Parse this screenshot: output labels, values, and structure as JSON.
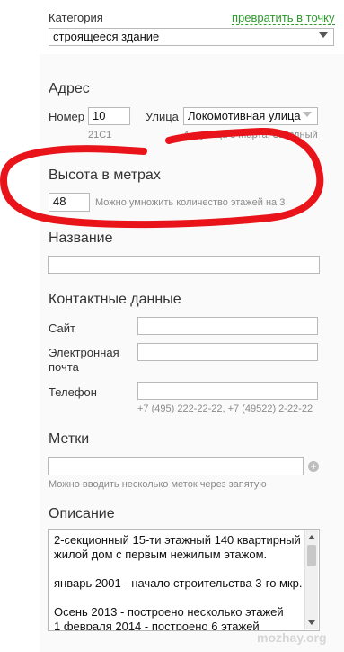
{
  "category": {
    "label": "Категория",
    "convert_link": "превратить в точку",
    "selected": "строящееся здание"
  },
  "address": {
    "heading": "Адрес",
    "number_label": "Номер",
    "number_value": "10",
    "number_hint": "21С1",
    "street_label": "Улица",
    "street_value": "Локомотивная улица",
    "street_hint": "4-я улица 8 Марта, Звёздный"
  },
  "height": {
    "heading": "Высота в метрах",
    "value": "48",
    "hint": "Можно умножить количество этажей на 3"
  },
  "name": {
    "heading": "Название",
    "value": ""
  },
  "contacts": {
    "heading": "Контактные данные",
    "site_label": "Сайт",
    "email_label_1": "Электронная",
    "email_label_2": "почта",
    "phone_label": "Телефон",
    "phone_hint": "+7 (495) 222-22-22, +7 (49522) 2-22-22"
  },
  "tags": {
    "heading": "Метки",
    "hint": "Можно вводить несколько меток через запятую"
  },
  "description": {
    "heading": "Описание",
    "line1": "2-секционный 15-ти этажный 140 квартирный",
    "line2": "жилой дом с первым нежилым этажом.",
    "line3": "январь 2001 - начало строительства 3-го мкр.",
    "line4": "Осень 2013 - построено несколько этажей",
    "line5": "1 февраля 2014 - построено 6 этажей"
  },
  "annotation_color": "#e8141a",
  "watermark": "mozhay.org"
}
